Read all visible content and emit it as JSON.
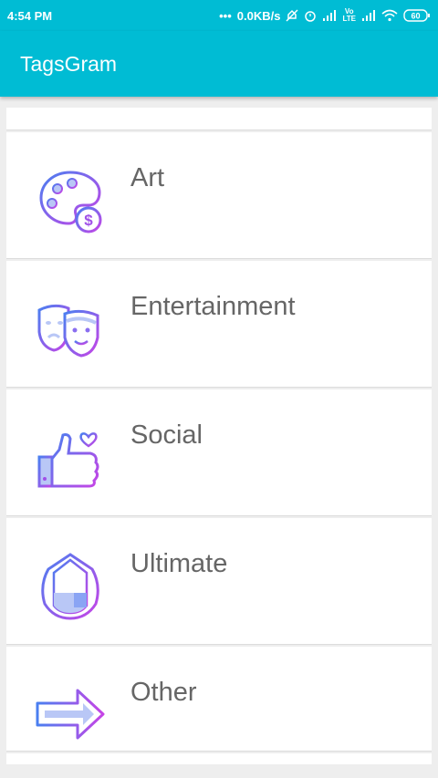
{
  "status_bar": {
    "time": "4:54 PM",
    "speed": "0.0KB/s",
    "battery": "60"
  },
  "app_bar": {
    "title": "TagsGram"
  },
  "categories": [
    {
      "label": "Art",
      "icon": "palette-dollar-icon"
    },
    {
      "label": "Entertainment",
      "icon": "theater-masks-icon"
    },
    {
      "label": "Social",
      "icon": "thumbs-up-heart-icon"
    },
    {
      "label": "Ultimate",
      "icon": "jar-icon"
    },
    {
      "label": "Other",
      "icon": "arrow-right-icon"
    }
  ],
  "colors": {
    "accent": "#00bcd4",
    "icon_start": "#4a7ff0",
    "icon_end": "#c644e6"
  }
}
